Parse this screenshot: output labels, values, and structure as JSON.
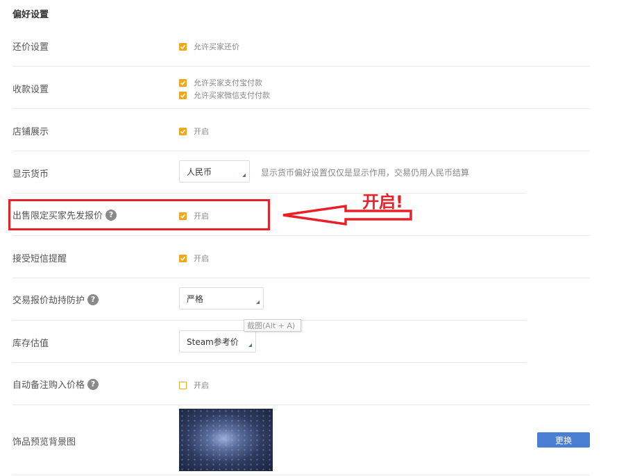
{
  "section_title": "偏好设置",
  "rows": {
    "bargain": {
      "label": "还价设置",
      "option": "允许买家还价",
      "checked": true
    },
    "payment": {
      "label": "收款设置",
      "options": [
        {
          "label": "允许买家支付宝付款",
          "checked": true
        },
        {
          "label": "允许买家微信支付付款",
          "checked": true
        }
      ]
    },
    "shop_display": {
      "label": "店铺展示",
      "option": "开启",
      "checked": true
    },
    "currency": {
      "label": "显示货币",
      "selected": "人民币",
      "hint": "显示货币偏好设置仅仅是显示作用，交易仍用人民币结算"
    },
    "buyer_offer_first": {
      "label": "出售限定买家先发报价",
      "option": "开启",
      "checked": true
    },
    "sms": {
      "label": "接受短信提醒",
      "option": "开启",
      "checked": true
    },
    "hijack_protection": {
      "label": "交易报价劫持防护",
      "selected": "严格"
    },
    "inventory_valuation": {
      "label": "库存估值",
      "selected": "Steam参考价"
    },
    "auto_note_price": {
      "label": "自动备注购入价格",
      "option": "开启",
      "checked": false
    },
    "preview_bg": {
      "label": "饰品预览背景图",
      "button": "更换"
    }
  },
  "tooltip": "截图(Alt + A)",
  "annotation": {
    "text": "开启!",
    "color": "#e8202a"
  },
  "colors": {
    "accent": "#f0a81a",
    "button": "#4a7ed2",
    "annotation": "#e8202a"
  },
  "icons": {
    "help": "question-mark-circle",
    "checkbox": "check",
    "select": "corner-triangle"
  }
}
